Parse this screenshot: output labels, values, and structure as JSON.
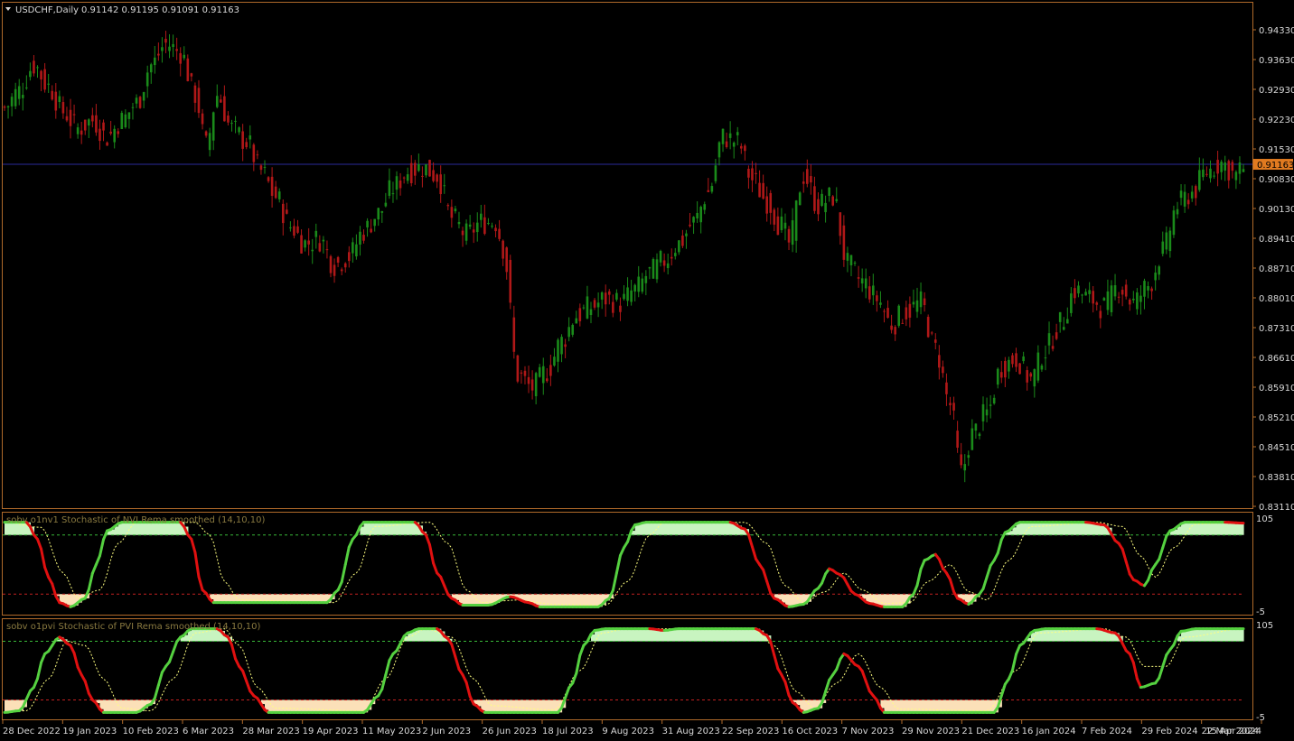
{
  "header": {
    "symbol": "USDCHF,Daily",
    "ohlc": "0.91142 0.91195 0.91091 0.91163"
  },
  "colors": {
    "background": "#000000",
    "frame": "#b06a2a",
    "bull_candle": "#1a8a1a",
    "bear_candle": "#b01818",
    "price_line": "#2a2a9a",
    "price_tag": "#e07a20",
    "osc_up": "#55d040",
    "osc_down": "#e01010",
    "fill_up": "#c8f4c0",
    "fill_down": "#fbe0b8",
    "signal": "#ffff80",
    "upper_level": "#38b838",
    "lower_level": "#c02020"
  },
  "chart_data": [
    {
      "type": "candlestick",
      "title": "USDCHF,Daily",
      "current_price": "0.91163",
      "y_ticks": [
        "0.94330",
        "0.93630",
        "0.92930",
        "0.92230",
        "0.91530",
        "0.90830",
        "0.90130",
        "0.89410",
        "0.88710",
        "0.88010",
        "0.87310",
        "0.86610",
        "0.85910",
        "0.85210",
        "0.84510",
        "0.83810",
        "0.83110"
      ],
      "ylim": [
        0.8311,
        0.9433
      ],
      "x_ticks": [
        "28 Dec 2022",
        "19 Jan 2023",
        "10 Feb 2023",
        "6 Mar 2023",
        "28 Mar 2023",
        "19 Apr 2023",
        "11 May 2023",
        "2 Jun 2023",
        "26 Jun 2023",
        "18 Jul 2023",
        "9 Aug 2023",
        "31 Aug 2023",
        "22 Sep 2023",
        "16 Oct 2023",
        "7 Nov 2023",
        "29 Nov 2023",
        "21 Dec 2023",
        "16 Jan 2024",
        "7 Feb 2024",
        "29 Feb 2024",
        "22 Mar 2024",
        "15 Apr 2024"
      ],
      "close_path": [
        [
          0,
          0.925
        ],
        [
          4,
          0.929
        ],
        [
          8,
          0.935
        ],
        [
          12,
          0.93
        ],
        [
          16,
          0.924
        ],
        [
          20,
          0.92
        ],
        [
          24,
          0.922
        ],
        [
          28,
          0.918
        ],
        [
          32,
          0.922
        ],
        [
          36,
          0.926
        ],
        [
          40,
          0.935
        ],
        [
          44,
          0.94
        ],
        [
          48,
          0.938
        ],
        [
          52,
          0.928
        ],
        [
          55,
          0.916
        ],
        [
          58,
          0.928
        ],
        [
          62,
          0.92
        ],
        [
          66,
          0.917
        ],
        [
          70,
          0.91
        ],
        [
          74,
          0.904
        ],
        [
          78,
          0.897
        ],
        [
          82,
          0.893
        ],
        [
          86,
          0.894
        ],
        [
          90,
          0.888
        ],
        [
          94,
          0.89
        ],
        [
          98,
          0.896
        ],
        [
          102,
          0.9
        ],
        [
          106,
          0.906
        ],
        [
          110,
          0.91
        ],
        [
          114,
          0.911
        ],
        [
          118,
          0.909
        ],
        [
          122,
          0.899
        ],
        [
          126,
          0.895
        ],
        [
          130,
          0.898
        ],
        [
          134,
          0.898
        ],
        [
          136,
          0.892
        ],
        [
          140,
          0.862
        ],
        [
          144,
          0.859
        ],
        [
          148,
          0.863
        ],
        [
          152,
          0.87
        ],
        [
          156,
          0.876
        ],
        [
          160,
          0.878
        ],
        [
          164,
          0.88
        ],
        [
          168,
          0.879
        ],
        [
          172,
          0.882
        ],
        [
          176,
          0.886
        ],
        [
          180,
          0.889
        ],
        [
          184,
          0.893
        ],
        [
          188,
          0.898
        ],
        [
          192,
          0.905
        ],
        [
          196,
          0.918
        ],
        [
          200,
          0.917
        ],
        [
          204,
          0.908
        ],
        [
          208,
          0.903
        ],
        [
          212,
          0.897
        ],
        [
          214,
          0.893
        ],
        [
          218,
          0.909
        ],
        [
          222,
          0.902
        ],
        [
          226,
          0.904
        ],
        [
          230,
          0.888
        ],
        [
          234,
          0.884
        ],
        [
          238,
          0.88
        ],
        [
          242,
          0.874
        ],
        [
          246,
          0.877
        ],
        [
          250,
          0.879
        ],
        [
          254,
          0.868
        ],
        [
          258,
          0.855
        ],
        [
          261,
          0.839
        ],
        [
          264,
          0.848
        ],
        [
          268,
          0.853
        ],
        [
          272,
          0.864
        ],
        [
          276,
          0.866
        ],
        [
          280,
          0.861
        ],
        [
          284,
          0.868
        ],
        [
          288,
          0.874
        ],
        [
          292,
          0.882
        ],
        [
          296,
          0.88
        ],
        [
          300,
          0.878
        ],
        [
          304,
          0.883
        ],
        [
          308,
          0.879
        ],
        [
          312,
          0.883
        ],
        [
          316,
          0.891
        ],
        [
          320,
          0.902
        ],
        [
          324,
          0.905
        ],
        [
          328,
          0.91
        ],
        [
          332,
          0.912
        ],
        [
          336,
          0.909
        ],
        [
          338,
          0.911
        ]
      ],
      "bars": 339
    },
    {
      "type": "line",
      "title": "sobv o1nv1 Stochastic of NVI Rema smoothed (14,10,10)",
      "levels": [
        "105",
        "-5"
      ],
      "ylim": [
        -5,
        105
      ],
      "upper_level": 85,
      "lower_level": 15,
      "main_line": [
        [
          0,
          100
        ],
        [
          6,
          100
        ],
        [
          9,
          80
        ],
        [
          12,
          35
        ],
        [
          15,
          5
        ],
        [
          18,
          0
        ],
        [
          22,
          10
        ],
        [
          25,
          50
        ],
        [
          28,
          90
        ],
        [
          32,
          100
        ],
        [
          48,
          100
        ],
        [
          51,
          80
        ],
        [
          54,
          20
        ],
        [
          57,
          5
        ],
        [
          88,
          5
        ],
        [
          91,
          20
        ],
        [
          95,
          80
        ],
        [
          98,
          100
        ],
        [
          112,
          100
        ],
        [
          115,
          85
        ],
        [
          118,
          40
        ],
        [
          122,
          10
        ],
        [
          125,
          2
        ],
        [
          132,
          2
        ],
        [
          138,
          12
        ],
        [
          143,
          5
        ],
        [
          146,
          0
        ],
        [
          162,
          0
        ],
        [
          165,
          10
        ],
        [
          169,
          70
        ],
        [
          172,
          97
        ],
        [
          175,
          100
        ],
        [
          198,
          100
        ],
        [
          202,
          92
        ],
        [
          206,
          50
        ],
        [
          210,
          10
        ],
        [
          214,
          0
        ],
        [
          218,
          3
        ],
        [
          222,
          22
        ],
        [
          225,
          45
        ],
        [
          228,
          38
        ],
        [
          232,
          15
        ],
        [
          236,
          4
        ],
        [
          240,
          0
        ],
        [
          245,
          0
        ],
        [
          248,
          15
        ],
        [
          251,
          55
        ],
        [
          254,
          62
        ],
        [
          257,
          40
        ],
        [
          260,
          10
        ],
        [
          263,
          3
        ],
        [
          266,
          15
        ],
        [
          270,
          55
        ],
        [
          273,
          88
        ],
        [
          277,
          100
        ],
        [
          295,
          100
        ],
        [
          300,
          97
        ],
        [
          304,
          75
        ],
        [
          308,
          32
        ],
        [
          311,
          25
        ],
        [
          314,
          50
        ],
        [
          318,
          90
        ],
        [
          322,
          100
        ],
        [
          333,
          100
        ],
        [
          338,
          99
        ]
      ],
      "signal_line": [
        [
          0,
          100
        ],
        [
          10,
          94
        ],
        [
          16,
          40
        ],
        [
          20,
          10
        ],
        [
          26,
          20
        ],
        [
          31,
          75
        ],
        [
          36,
          100
        ],
        [
          52,
          100
        ],
        [
          56,
          85
        ],
        [
          60,
          30
        ],
        [
          64,
          8
        ],
        [
          90,
          5
        ],
        [
          96,
          40
        ],
        [
          101,
          95
        ],
        [
          116,
          100
        ],
        [
          121,
          75
        ],
        [
          126,
          20
        ],
        [
          130,
          5
        ],
        [
          140,
          8
        ],
        [
          150,
          3
        ],
        [
          164,
          2
        ],
        [
          170,
          30
        ],
        [
          176,
          85
        ],
        [
          180,
          100
        ],
        [
          202,
          100
        ],
        [
          208,
          75
        ],
        [
          213,
          25
        ],
        [
          218,
          5
        ],
        [
          224,
          18
        ],
        [
          229,
          40
        ],
        [
          234,
          20
        ],
        [
          240,
          4
        ],
        [
          247,
          5
        ],
        [
          252,
          30
        ],
        [
          258,
          50
        ],
        [
          263,
          18
        ],
        [
          268,
          8
        ],
        [
          274,
          55
        ],
        [
          280,
          95
        ],
        [
          298,
          100
        ],
        [
          305,
          95
        ],
        [
          310,
          60
        ],
        [
          314,
          35
        ],
        [
          319,
          70
        ],
        [
          325,
          98
        ],
        [
          338,
          100
        ]
      ]
    },
    {
      "type": "line",
      "title": "sobv o1pvi Stochastic of PVI Rema smoothed (14,10,10)",
      "levels": [
        "105",
        "-5"
      ],
      "ylim": [
        -5,
        105
      ],
      "upper_level": 85,
      "lower_level": 15,
      "main_line": [
        [
          0,
          0
        ],
        [
          4,
          2
        ],
        [
          8,
          30
        ],
        [
          11,
          70
        ],
        [
          15,
          90
        ],
        [
          18,
          80
        ],
        [
          21,
          45
        ],
        [
          24,
          15
        ],
        [
          27,
          0
        ],
        [
          36,
          0
        ],
        [
          40,
          10
        ],
        [
          44,
          55
        ],
        [
          48,
          90
        ],
        [
          51,
          100
        ],
        [
          58,
          100
        ],
        [
          61,
          90
        ],
        [
          64,
          55
        ],
        [
          68,
          20
        ],
        [
          72,
          0
        ],
        [
          98,
          0
        ],
        [
          102,
          20
        ],
        [
          106,
          70
        ],
        [
          110,
          95
        ],
        [
          113,
          100
        ],
        [
          118,
          100
        ],
        [
          121,
          88
        ],
        [
          125,
          45
        ],
        [
          128,
          10
        ],
        [
          131,
          0
        ],
        [
          151,
          0
        ],
        [
          155,
          35
        ],
        [
          158,
          80
        ],
        [
          161,
          98
        ],
        [
          164,
          100
        ],
        [
          176,
          100
        ],
        [
          180,
          98
        ],
        [
          184,
          100
        ],
        [
          205,
          100
        ],
        [
          208,
          92
        ],
        [
          212,
          45
        ],
        [
          215,
          12
        ],
        [
          218,
          0
        ],
        [
          222,
          5
        ],
        [
          226,
          45
        ],
        [
          229,
          70
        ],
        [
          233,
          55
        ],
        [
          237,
          20
        ],
        [
          240,
          0
        ],
        [
          270,
          0
        ],
        [
          274,
          40
        ],
        [
          277,
          80
        ],
        [
          281,
          98
        ],
        [
          284,
          100
        ],
        [
          298,
          100
        ],
        [
          303,
          95
        ],
        [
          307,
          70
        ],
        [
          310,
          30
        ],
        [
          314,
          35
        ],
        [
          318,
          75
        ],
        [
          321,
          97
        ],
        [
          325,
          100
        ],
        [
          338,
          100
        ]
      ],
      "signal_line": [
        [
          0,
          0
        ],
        [
          6,
          2
        ],
        [
          12,
          40
        ],
        [
          17,
          85
        ],
        [
          22,
          80
        ],
        [
          27,
          40
        ],
        [
          32,
          5
        ],
        [
          40,
          2
        ],
        [
          46,
          40
        ],
        [
          52,
          95
        ],
        [
          60,
          100
        ],
        [
          64,
          80
        ],
        [
          69,
          30
        ],
        [
          74,
          5
        ],
        [
          98,
          2
        ],
        [
          104,
          40
        ],
        [
          110,
          90
        ],
        [
          115,
          100
        ],
        [
          122,
          90
        ],
        [
          128,
          40
        ],
        [
          133,
          8
        ],
        [
          150,
          3
        ],
        [
          157,
          50
        ],
        [
          163,
          95
        ],
        [
          170,
          100
        ],
        [
          204,
          100
        ],
        [
          210,
          80
        ],
        [
          216,
          25
        ],
        [
          221,
          5
        ],
        [
          227,
          35
        ],
        [
          233,
          70
        ],
        [
          239,
          30
        ],
        [
          244,
          4
        ],
        [
          268,
          2
        ],
        [
          276,
          50
        ],
        [
          282,
          95
        ],
        [
          300,
          100
        ],
        [
          306,
          90
        ],
        [
          311,
          55
        ],
        [
          317,
          55
        ],
        [
          322,
          90
        ],
        [
          338,
          100
        ]
      ]
    }
  ]
}
